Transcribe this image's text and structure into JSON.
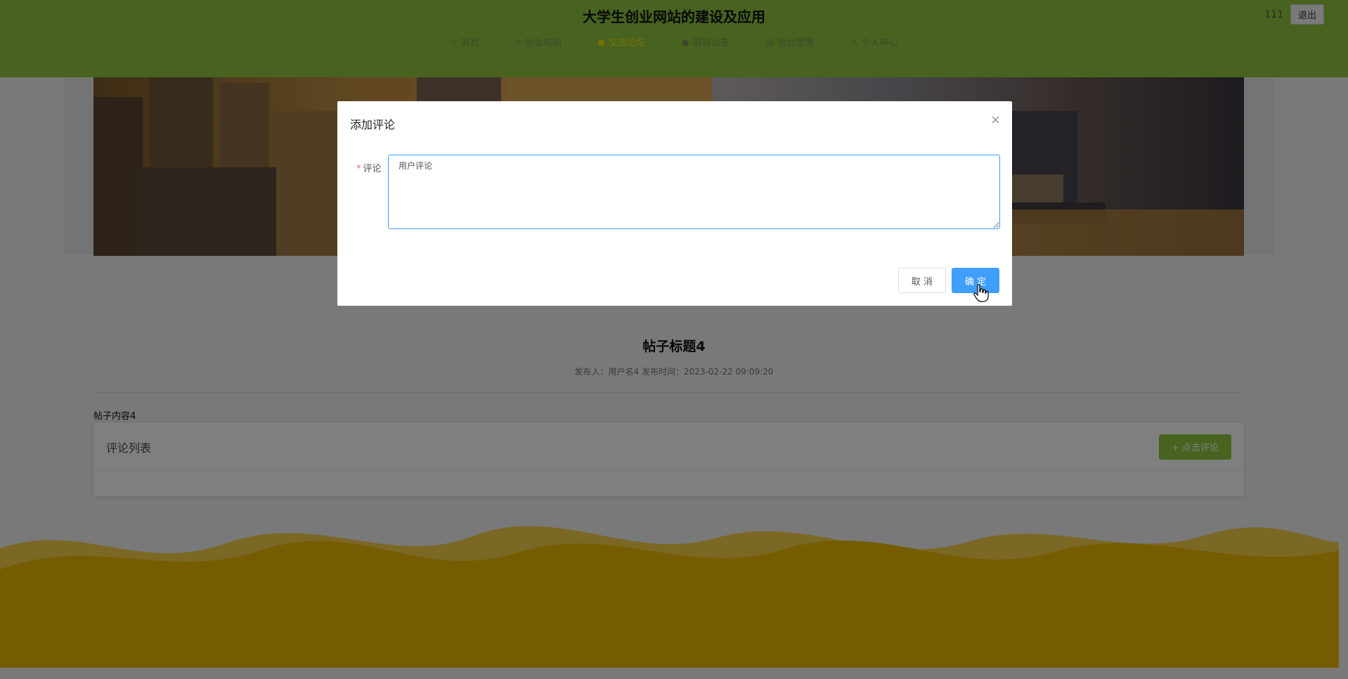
{
  "header": {
    "site_title": "大学生创业网站的建设及应用",
    "nav": [
      {
        "label": "首页",
        "icon": "star-icon"
      },
      {
        "label": "创业培训",
        "icon": "bag-icon"
      },
      {
        "label": "交流论坛",
        "icon": "dot-icon",
        "active": true
      },
      {
        "label": "项目公告",
        "icon": "info-icon"
      },
      {
        "label": "后台管理",
        "icon": "calendar-icon"
      },
      {
        "label": "个人中心",
        "icon": "user-icon"
      }
    ],
    "username": "111",
    "logout_label": "退出"
  },
  "post": {
    "title": "帖子标题4",
    "meta": "发布人：用户名4  发布时间：2023-02-22 09:09:20",
    "content": "帖子内容4"
  },
  "comments": {
    "list_title": "评论列表",
    "add_button_label": "+ 点击评论"
  },
  "modal": {
    "title": "添加评论",
    "close_glyph": "×",
    "field_label": "评论",
    "required_mark": "*",
    "textarea_placeholder": "用户评论",
    "cancel_label": "取 消",
    "ok_label": "确 定"
  },
  "colors": {
    "header_green": "#8fc73f",
    "active_nav": "#f2e30f",
    "primary_blue": "#409eff",
    "footer_yellow": "#e9b700"
  }
}
